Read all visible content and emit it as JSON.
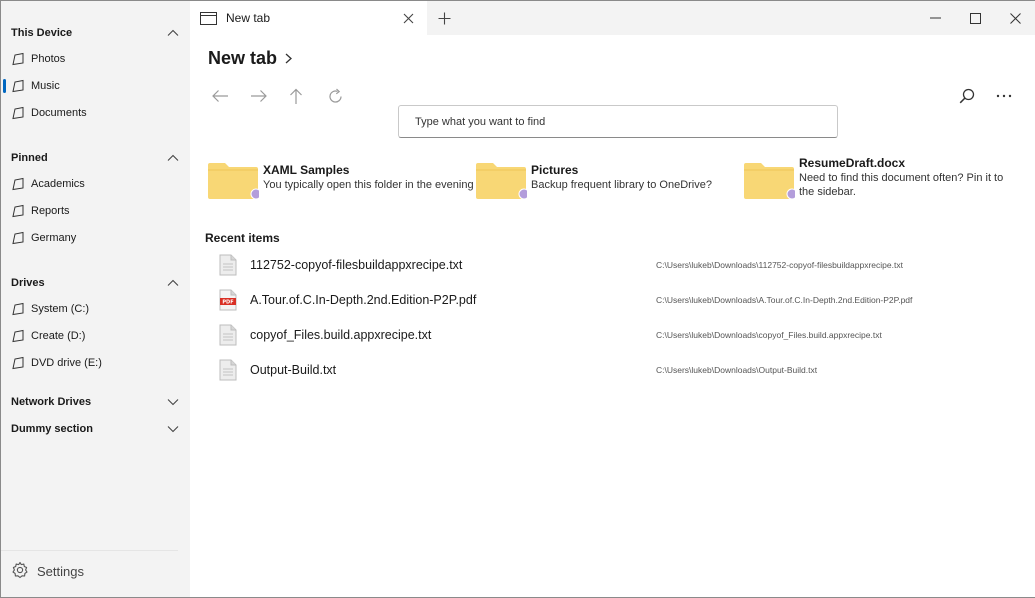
{
  "sidebar": {
    "sections": [
      {
        "header": "This Device",
        "expanded": true,
        "items": [
          "Photos",
          "Music",
          "Documents"
        ]
      },
      {
        "header": "Pinned",
        "expanded": true,
        "items": [
          "Academics",
          "Reports",
          "Germany"
        ]
      },
      {
        "header": "Drives",
        "expanded": true,
        "items": [
          "System (C:)",
          "Create (D:)",
          "DVD drive (E:)"
        ]
      },
      {
        "header": "Network Drives",
        "expanded": false,
        "items": []
      },
      {
        "header": "Dummy section",
        "expanded": false,
        "items": []
      }
    ],
    "selected_item": "Music",
    "settings_label": "Settings"
  },
  "tabs": {
    "active_tab_label": "New tab"
  },
  "header": {
    "breadcrumb": "New tab"
  },
  "search": {
    "placeholder": "Type what you want to find"
  },
  "suggestions": [
    {
      "title": "XAML Samples",
      "subtitle": "You typically open this folder in the evening"
    },
    {
      "title": "Pictures",
      "subtitle": "Backup frequent library to OneDrive?"
    },
    {
      "title": "ResumeDraft.docx",
      "subtitle_line1": "Need to find this document often? Pin it to",
      "subtitle_line2": "the sidebar."
    }
  ],
  "recent": {
    "title": "Recent items",
    "items": [
      {
        "name": "112752-copyof-filesbuildappxrecipe.txt",
        "path": "C:\\Users\\lukeb\\Downloads\\112752-copyof-filesbuildappxrecipe.txt",
        "icon": "text-file-icon"
      },
      {
        "name": "A.Tour.of.C.In-Depth.2nd.Edition-P2P.pdf",
        "path": "C:\\Users\\lukeb\\Downloads\\A.Tour.of.C.In-Depth.2nd.Edition-P2P.pdf",
        "icon": "pdf-file-icon",
        "icon_label": "PDF"
      },
      {
        "name": "copyof_Files.build.appxrecipe.txt",
        "path": "C:\\Users\\lukeb\\Downloads\\copyof_Files.build.appxrecipe.txt",
        "icon": "text-file-icon"
      },
      {
        "name": "Output-Build.txt",
        "path": "C:\\Users\\lukeb\\Downloads\\Output-Build.txt",
        "icon": "text-file-icon"
      }
    ]
  },
  "colors": {
    "sidebar_bg": "#f3f3f3",
    "accent": "#0067c0",
    "folder_yellow": "#f8d775",
    "pdf_red": "#d93025",
    "badge_purple": "#b39ddb"
  }
}
